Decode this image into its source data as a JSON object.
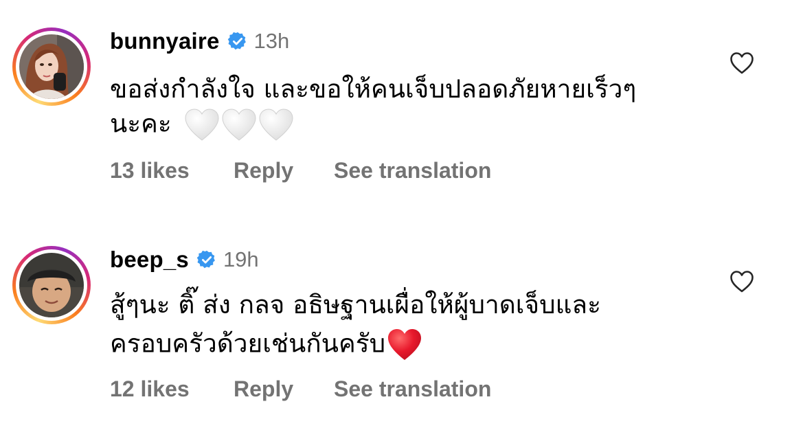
{
  "comments": [
    {
      "username": "bunnyaire",
      "verified": true,
      "time": "13h",
      "text_line1": "ขอส่งกำลังใจ และขอให้คนเจ็บปลอดภัยหายเร็วๆ",
      "text_line2": "นะคะ",
      "emoji": [
        "white-heart",
        "white-heart",
        "white-heart"
      ],
      "likes": "13 likes",
      "reply": "Reply",
      "see_translation": "See translation"
    },
    {
      "username": "beep_s",
      "verified": true,
      "time": "19h",
      "text_line1": "สู้ๆนะ ติ๊ ส่ง กลจ อธิษฐานเผื่อให้ผู้บาดเจ็บและ",
      "text_line2": "ครอบครัวด้วยเช่นกันครับ",
      "emoji": [
        "red-heart"
      ],
      "likes": "12 likes",
      "reply": "Reply",
      "see_translation": "See translation"
    }
  ],
  "colors": {
    "verified_badge": "#3897f0",
    "secondary_text": "#737373",
    "heart_outline": "#262626",
    "red_heart": "#e8192c"
  },
  "icons": {
    "verified": "verified-badge-icon",
    "like": "heart-outline-icon"
  }
}
